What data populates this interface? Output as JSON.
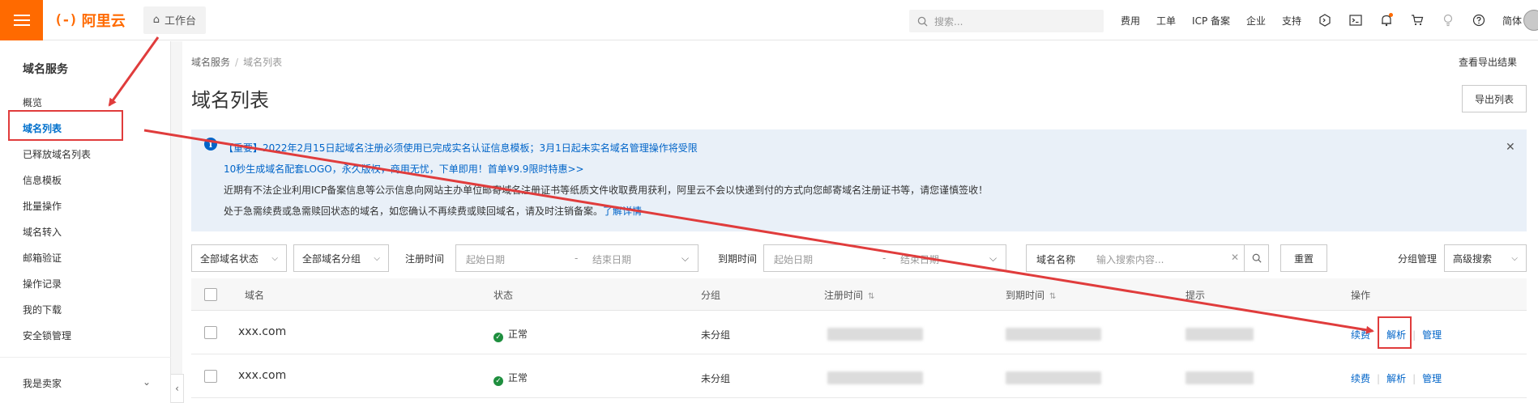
{
  "topbar": {
    "logo_mark": "(-)",
    "logo_text": "阿里云",
    "workbench_label": "工作台",
    "search_placeholder": "搜索...",
    "nav": [
      "费用",
      "工单",
      "ICP 备案",
      "企业",
      "支持"
    ],
    "lang": "简体"
  },
  "sidebar": {
    "title": "域名服务",
    "items": [
      {
        "label": "概览"
      },
      {
        "label": "域名列表",
        "active": true
      },
      {
        "label": "已释放域名列表"
      },
      {
        "label": "信息模板"
      },
      {
        "label": "批量操作"
      },
      {
        "label": "域名转入"
      },
      {
        "label": "邮箱验证"
      },
      {
        "label": "操作记录"
      },
      {
        "label": "我的下载"
      },
      {
        "label": "安全锁管理"
      }
    ],
    "footer": "我是卖家"
  },
  "main": {
    "breadcrumb": [
      "域名服务",
      "域名列表"
    ],
    "title": "域名列表",
    "export_result_link": "查看导出结果",
    "export_button": "导出列表",
    "notice": {
      "line1": "【重要】2022年2月15日起域名注册必须使用已完成实名认证信息模板；3月1日起未实名域名管理操作将受限",
      "line2": "10秒生成域名配套LOGO，永久版权，商用无忧，下单即用！首单¥9.9限时特惠>>",
      "line3": "近期有不法企业利用ICP备案信息等公示信息向网站主办单位邮寄域名注册证书等纸质文件收取费用获利，阿里云不会以快递到付的方式向您邮寄域名注册证书等，请您谨慎签收！",
      "line4_text": "处于急需续费或急需赎回状态的域名，如您确认不再续费或赎回域名，请及时注销备案。",
      "line4_link": "了解详情"
    },
    "filters": {
      "status_select": "全部域名状态",
      "group_select": "全部域名分组",
      "reg_time_label": "注册时间",
      "reg_start": "起始日期",
      "reg_end": "结束日期",
      "range_sep": "-",
      "exp_time_label": "到期时间",
      "exp_start": "起始日期",
      "exp_end": "结束日期",
      "search_label": "域名名称",
      "search_placeholder": "输入搜索内容...",
      "reset_button": "重置",
      "group_manage": "分组管理",
      "advanced_search": "高级搜索"
    },
    "table": {
      "columns": [
        "域名",
        "状态",
        "分组",
        "注册时间",
        "到期时间",
        "提示",
        "操作"
      ],
      "rows": [
        {
          "domain": "xxx.com",
          "status": "正常",
          "group": "未分组",
          "actions": [
            "续费",
            "解析",
            "管理"
          ]
        },
        {
          "domain": "xxx.com",
          "status": "正常",
          "group": "未分组",
          "actions": [
            "续费",
            "解析",
            "管理"
          ]
        }
      ]
    }
  },
  "colors": {
    "brand": "#ff6a00",
    "link": "#0064c8",
    "annotation": "#e03c3c",
    "status_ok": "#1e8e3e"
  }
}
